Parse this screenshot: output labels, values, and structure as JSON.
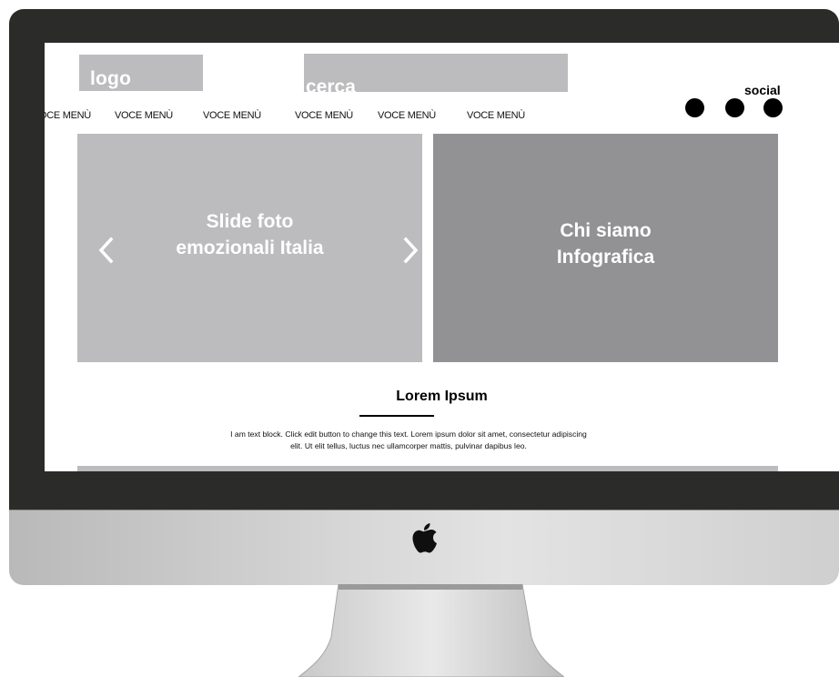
{
  "header": {
    "logo_label": "logo",
    "search_label": "cerca",
    "social_label": "social"
  },
  "menu": {
    "items": [
      "VOCE MENÙ",
      "VOCE MENÙ",
      "VOCE MENÙ",
      "VOCE MENÙ",
      "VOCE MENÙ",
      "VOCE MENÙ"
    ]
  },
  "social": {
    "icons": [
      "social-icon-1",
      "social-icon-2",
      "social-icon-3"
    ]
  },
  "slider": {
    "line1": "Slide foto",
    "line2": "emozionali Italia",
    "prev_icon": "chevron-left-icon",
    "next_icon": "chevron-right-icon"
  },
  "info_panel": {
    "line1": "Chi siamo",
    "line2": "Infografica"
  },
  "content": {
    "title": "Lorem Ipsum",
    "body_line1": "I am text block. Click edit button to change this text. Lorem ipsum dolor sit amet, consectetur adipiscing",
    "body_line2": "elit. Ut elit tellus, luctus nec ullamcorper mattis, pulvinar dapibus leo."
  },
  "colors": {
    "placeholder_light": "#bcbcbe",
    "placeholder_dark": "#929294",
    "bezel": "#2b2b29",
    "text": "#000000"
  }
}
